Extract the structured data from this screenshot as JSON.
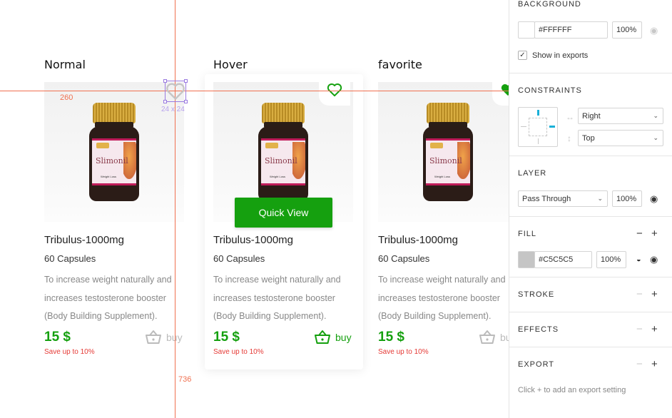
{
  "canvas": {
    "columns": [
      {
        "title": "Normal"
      },
      {
        "title": "Hover"
      },
      {
        "title": "favorite"
      }
    ],
    "product": {
      "name": "Tribulus-1000mg",
      "capsules": "60 Capsules",
      "description": [
        "To increase weight naturally and",
        "increases testosterone booster",
        "(Body Building Supplement)."
      ],
      "price": "15 $",
      "save": "Save up to 10%",
      "buy_label": "buy",
      "bottle_label": "Slimonil",
      "bottle_sub": "Weight Loss"
    },
    "quick_view_label": "Quick View",
    "measurements": {
      "horizontal": "260",
      "vertical": "736"
    },
    "selection_size": "24 x 24",
    "colors": {
      "green": "#15a00f",
      "red": "#e53935",
      "guide": "#f07050",
      "selection": "#9a7ae0"
    }
  },
  "panel": {
    "background": {
      "title": "BACKGROUND",
      "hex": "#FFFFFF",
      "opacity": "100%",
      "show_in_exports": "Show in exports"
    },
    "constraints": {
      "title": "CONSTRAINTS",
      "horizontal": "Right",
      "vertical": "Top"
    },
    "layer": {
      "title": "LAYER",
      "blend": "Pass Through",
      "opacity": "100%"
    },
    "fill": {
      "title": "FILL",
      "hex": "#C5C5C5",
      "opacity": "100%",
      "color": "#C5C5C5"
    },
    "stroke": {
      "title": "STROKE"
    },
    "effects": {
      "title": "EFFECTS"
    },
    "export": {
      "title": "EXPORT",
      "hint": "Click + to add an export setting"
    }
  }
}
